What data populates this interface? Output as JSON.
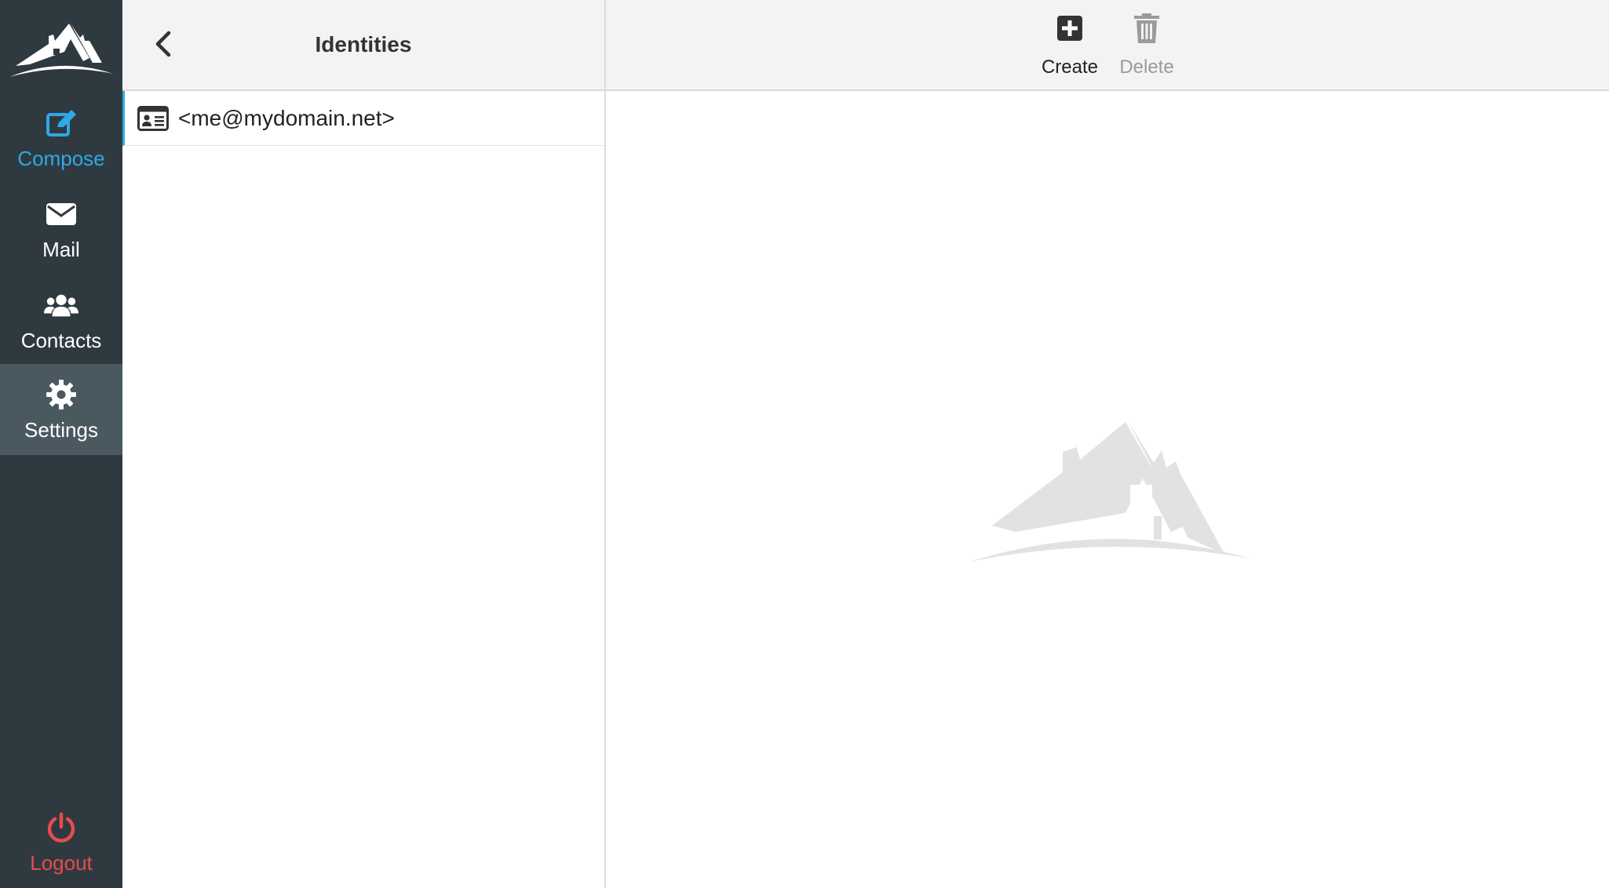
{
  "sidebar": {
    "items": [
      {
        "label": "Compose",
        "icon": "compose-icon"
      },
      {
        "label": "Mail",
        "icon": "envelope-icon"
      },
      {
        "label": "Contacts",
        "icon": "users-icon"
      },
      {
        "label": "Settings",
        "icon": "gear-icon"
      }
    ],
    "logout": {
      "label": "Logout",
      "icon": "power-icon"
    },
    "active": "Settings"
  },
  "list": {
    "title": "Identities",
    "items": [
      {
        "label": "<me@mydomain.net>",
        "icon": "id-card-icon"
      }
    ]
  },
  "toolbar": {
    "create_label": "Create",
    "delete_label": "Delete"
  },
  "colors": {
    "sidebar_bg": "#2f3a40",
    "sidebar_active_bg": "#4a5960",
    "accent": "#2ea8e8",
    "logout": "#e84c4c",
    "disabled": "#9a9a9a"
  }
}
